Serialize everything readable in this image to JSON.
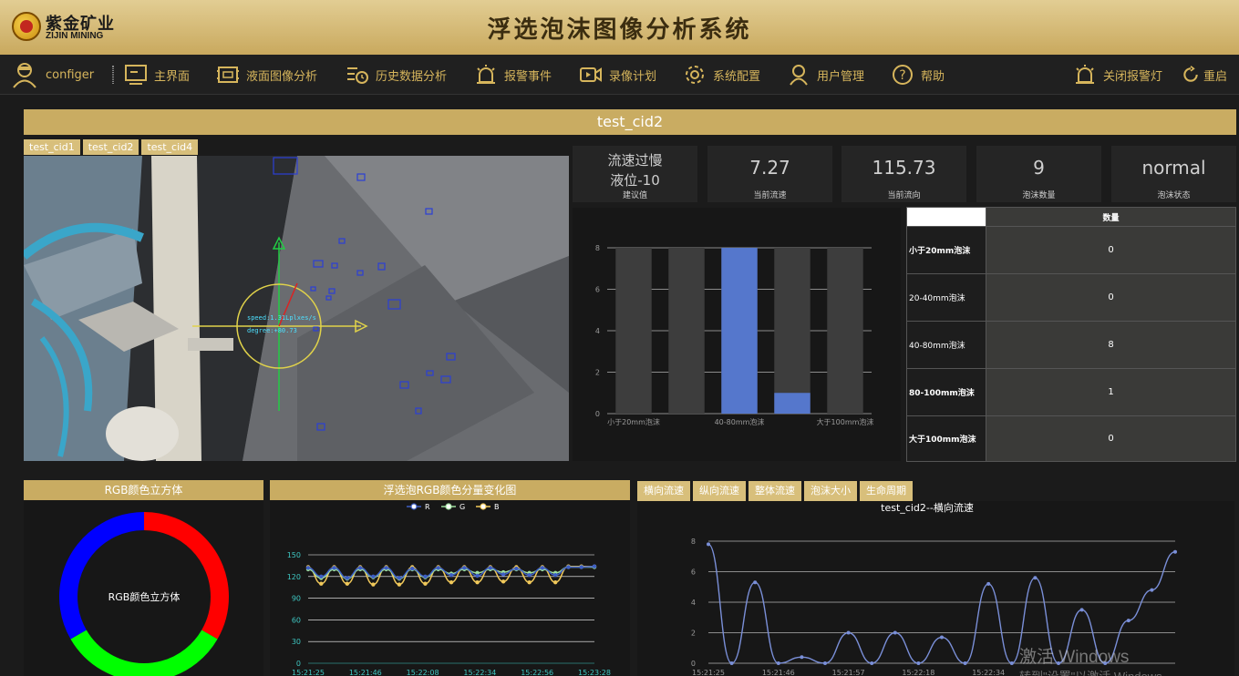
{
  "header": {
    "title": "浮选泡沫图像分析系统",
    "logo_cn": "紫金矿业",
    "logo_en": "ZIJIN MINING"
  },
  "nav": {
    "user": "configer",
    "items": [
      {
        "label": "主界面",
        "icon": "monitor-icon"
      },
      {
        "label": "液面图像分析",
        "icon": "frame-icon"
      },
      {
        "label": "历史数据分析",
        "icon": "history-icon"
      },
      {
        "label": "报警事件",
        "icon": "alarm-icon"
      },
      {
        "label": "录像计划",
        "icon": "video-icon"
      },
      {
        "label": "系统配置",
        "icon": "gear-icon"
      },
      {
        "label": "用户管理",
        "icon": "user-icon"
      },
      {
        "label": "帮助",
        "icon": "help-icon"
      }
    ],
    "alarm_off": "关闭报警灯",
    "restart": "重启"
  },
  "camera": {
    "title": "test_cid2",
    "tabs": [
      "test_cid1",
      "test_cid2",
      "test_cid4"
    ],
    "overlay_speed": "speed:1.31Lplxes/s",
    "overlay_degree": "degree:+80.73"
  },
  "kpis": [
    {
      "value_line1": "流速过慢",
      "value_line2": "液位-10",
      "label": "建议值"
    },
    {
      "value": "7.27",
      "label": "当前流速"
    },
    {
      "value": "115.73",
      "label": "当前流向"
    },
    {
      "value": "9",
      "label": "泡沫数量"
    },
    {
      "value": "normal",
      "label": "泡沫状态"
    }
  ],
  "bubble_chart": {
    "type": "bar",
    "categories": [
      "小于20mm泡沫",
      "20-40mm泡沫",
      "40-80mm泡沫",
      "80-100mm泡沫",
      "大于100mm泡沫"
    ],
    "tick_labels": [
      "小于20mm泡沫",
      "40-80mm泡沫",
      "大于100mm泡沫"
    ],
    "values": [
      0,
      0,
      8,
      1,
      0
    ],
    "yticks": [
      0,
      2,
      4,
      6,
      8
    ],
    "ylim": [
      0,
      8
    ],
    "bar_color": "#5577cc"
  },
  "bubble_table": {
    "header": "数量",
    "rows": [
      {
        "label": "小于20mm泡沫",
        "value": "0"
      },
      {
        "label": "20-40mm泡沫",
        "value": "0"
      },
      {
        "label": "40-80mm泡沫",
        "value": "8"
      },
      {
        "label": "80-100mm泡沫",
        "value": "1"
      },
      {
        "label": "大于100mm泡沫",
        "value": "0"
      }
    ]
  },
  "rgb_cube": {
    "title": "RGB颜色立方体",
    "center": "RGB颜色立方体",
    "colors": [
      "#ff0000",
      "#00ff00",
      "#0000ff"
    ]
  },
  "rgb_chart": {
    "title": "浮选泡RGB颜色分量变化图",
    "type": "line",
    "legend": [
      "R",
      "G",
      "B"
    ],
    "colors": [
      "#3d5ec4",
      "#9fdf9f",
      "#f0c85a"
    ],
    "x": [
      "15:21:25",
      "15:21:46",
      "15:22:08",
      "15:22:34",
      "15:22:56",
      "15:23:28"
    ],
    "yticks": [
      0,
      30,
      60,
      90,
      120,
      150
    ],
    "ylim": [
      0,
      150
    ],
    "series": [
      {
        "name": "R",
        "values": [
          132,
          120,
          132,
          118,
          132,
          120,
          132,
          118,
          131,
          120,
          132,
          122,
          132,
          121,
          132,
          123,
          131,
          122,
          132,
          122,
          133,
          133,
          134
        ]
      },
      {
        "name": "G",
        "values": [
          130,
          118,
          130,
          117,
          130,
          119,
          130,
          117,
          130,
          119,
          130,
          124,
          130,
          125,
          130,
          126,
          130,
          125,
          130,
          125,
          133,
          133,
          133
        ]
      },
      {
        "name": "B",
        "values": [
          133,
          110,
          133,
          110,
          133,
          109,
          133,
          109,
          133,
          110,
          133,
          112,
          133,
          112,
          133,
          113,
          133,
          112,
          133,
          112,
          134,
          134,
          134
        ]
      }
    ]
  },
  "flow_tabs": [
    "横向流速",
    "纵向流速",
    "整体流速",
    "泡沫大小",
    "生命周期"
  ],
  "flow_chart": {
    "title": "test_cid2--横向流速",
    "type": "line",
    "x": [
      "15:21:25",
      "15:21:46",
      "15:21:57",
      "15:22:18",
      "15:22:34"
    ],
    "yticks": [
      0,
      2,
      4,
      6,
      8
    ],
    "ylim": [
      0,
      8
    ],
    "color": "#7a8fd8",
    "values": [
      7.8,
      0,
      5.3,
      0,
      0.4,
      0,
      2,
      0,
      2,
      0,
      1.7,
      0,
      5.2,
      0,
      5.6,
      0,
      3.5,
      0,
      2.8,
      4.8,
      7.3
    ]
  },
  "watermark": {
    "line1": "激活 Windows",
    "line2": "转到\"设置\"以激活 Windows。"
  }
}
